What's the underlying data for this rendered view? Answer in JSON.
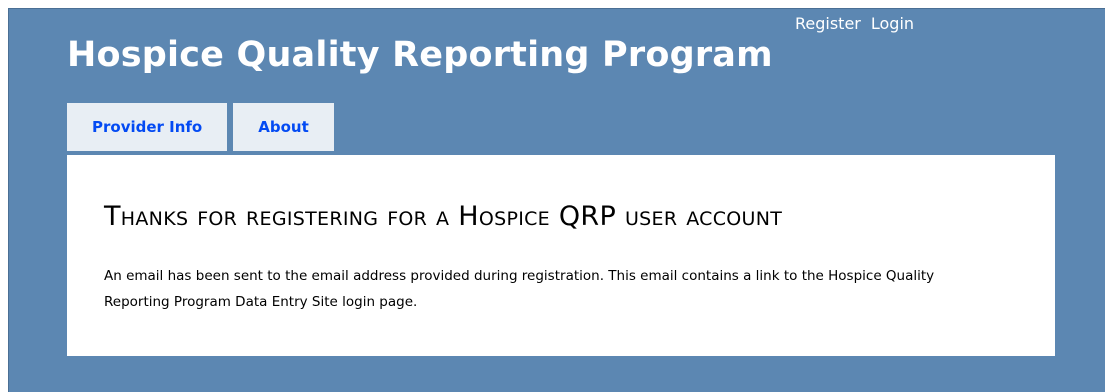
{
  "header": {
    "register_label": "Register",
    "login_label": "Login",
    "title": "Hospice Quality Reporting Program"
  },
  "menu": {
    "items": [
      {
        "label": "Provider Info"
      },
      {
        "label": "About"
      }
    ]
  },
  "main": {
    "heading": "Thanks for registering for a Hospice QRP user account",
    "message": "An email has been sent to the email address provided during registration. This email contains a link to the Hospice Quality Reporting Program Data Entry Site login page."
  },
  "colors": {
    "background": "#5c87b2",
    "tab_background": "#e8eef4",
    "tab_text": "#034af3",
    "content_background": "#ffffff"
  }
}
